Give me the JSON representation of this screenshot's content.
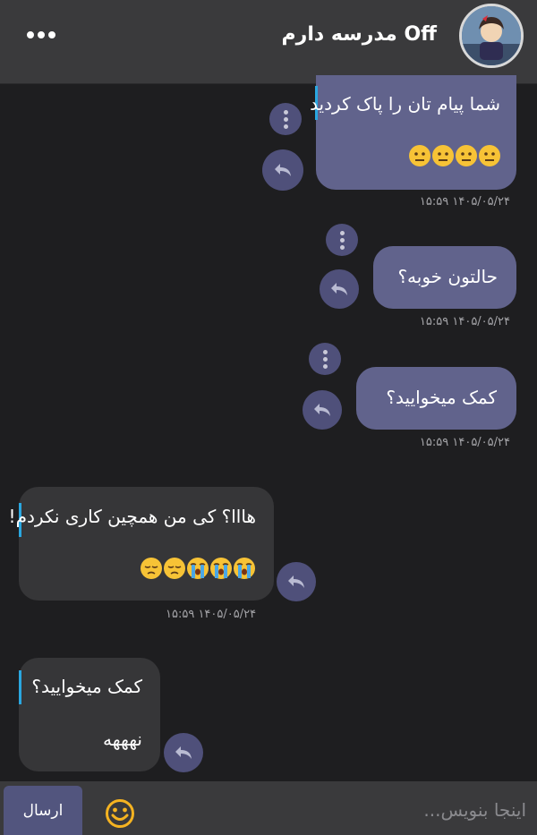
{
  "header": {
    "title": "Off مدرسه دارم",
    "more_icon": "more-horizontal-icon"
  },
  "messages": [
    {
      "direction": "out",
      "text": "شما پیام تان را پاک کردید",
      "emojis": [
        "neutral-face",
        "neutral-face",
        "neutral-face",
        "neutral-face"
      ],
      "timestamp": "۱۴۰۵/۰۵/۲۴ ۱۵:۵۹"
    },
    {
      "direction": "out",
      "text": "حالتون خوبه؟",
      "timestamp": "۱۴۰۵/۰۵/۲۴ ۱۵:۵۹"
    },
    {
      "direction": "out",
      "text": "کمک میخوایید؟",
      "timestamp": "۱۴۰۵/۰۵/۲۴ ۱۵:۵۹"
    },
    {
      "direction": "in",
      "text": "هااا؟ کی من همچین کاری نکردم!",
      "emojis": [
        "crying-face",
        "crying-face",
        "crying-face",
        "pensive-face",
        "pensive-face"
      ],
      "timestamp": "۱۴۰۵/۰۵/۲۴ ۱۵:۵۹"
    },
    {
      "direction": "in",
      "quoted": "کمک میخوایید؟",
      "text": "نهههه"
    }
  ],
  "composer": {
    "send_label": "ارسال",
    "placeholder": "اینجا بنویس..."
  },
  "colors": {
    "background": "#1e1e20",
    "header": "#3a3a3c",
    "outgoing_bubble": "#61638c",
    "incoming_bubble": "#363638",
    "reply_accent": "#2aa7e0",
    "emoji_button": "#f5b321"
  }
}
